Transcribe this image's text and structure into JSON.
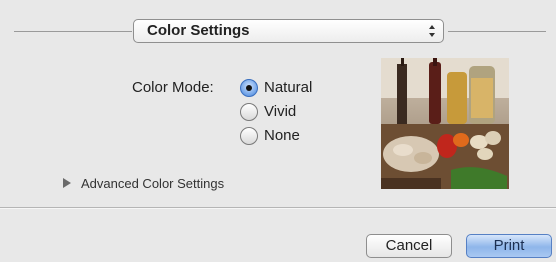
{
  "popup": {
    "label": "Color Settings",
    "icon": "updown-arrows-icon"
  },
  "color_mode": {
    "label": "Color Mode:",
    "options": [
      {
        "label": "Natural",
        "selected": true
      },
      {
        "label": "Vivid",
        "selected": false
      },
      {
        "label": "None",
        "selected": false
      }
    ]
  },
  "preview": {
    "icon": "preview-photo"
  },
  "advanced": {
    "label": "Advanced Color Settings",
    "icon": "disclosure-triangle-icon"
  },
  "buttons": {
    "cancel": "Cancel",
    "print": "Print"
  },
  "colors": {
    "accent": "#6ca0e6",
    "background": "#e8e8e8"
  }
}
